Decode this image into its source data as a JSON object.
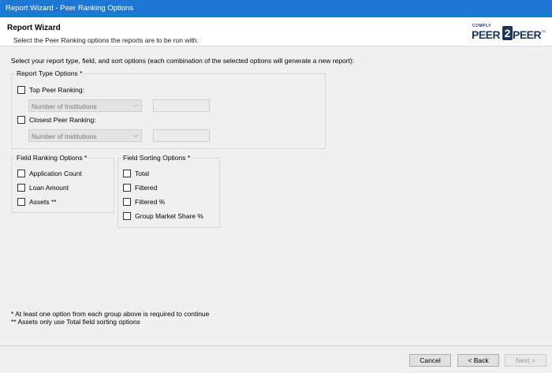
{
  "window": {
    "title": "Report Wizard - Peer Ranking Options"
  },
  "header": {
    "title": "Report Wizard",
    "subtitle": "Select the Peer Ranking options the reports are to be run with.",
    "logo": {
      "top_text": "COMPLY",
      "word_left": "PEER",
      "middle": "2",
      "word_right": "PEER",
      "mark": "TM"
    }
  },
  "intro": "Select your report type, field, and sort options (each combination of the selected options will generate a new report):",
  "report_type": {
    "legend": "Report Type Options *",
    "top_peer": {
      "label": "Top Peer Ranking:",
      "checked": false,
      "combo": "Number of Institutions",
      "text_value": ""
    },
    "closest_peer": {
      "label": "Closest Peer Ranking:",
      "checked": false,
      "combo": "Number of Institutions",
      "text_value": ""
    }
  },
  "field_ranking": {
    "legend": "Field Ranking Options *",
    "options": [
      {
        "label": "Application Count",
        "checked": false
      },
      {
        "label": "Loan Amount",
        "checked": false
      },
      {
        "label": "Assets **",
        "checked": false
      }
    ]
  },
  "field_sorting": {
    "legend": "Field Sorting Options *",
    "options": [
      {
        "label": "Total",
        "checked": false
      },
      {
        "label": "Filtered",
        "checked": false
      },
      {
        "label": "Filtered %",
        "checked": false
      },
      {
        "label": "Group Market Share %",
        "checked": false
      }
    ]
  },
  "footnotes": [
    "* At least one option from each group above is required to continue",
    "** Assets only use Total field sorting options"
  ],
  "buttons": {
    "cancel": "Cancel",
    "back": "< Back",
    "next": "Next >"
  }
}
